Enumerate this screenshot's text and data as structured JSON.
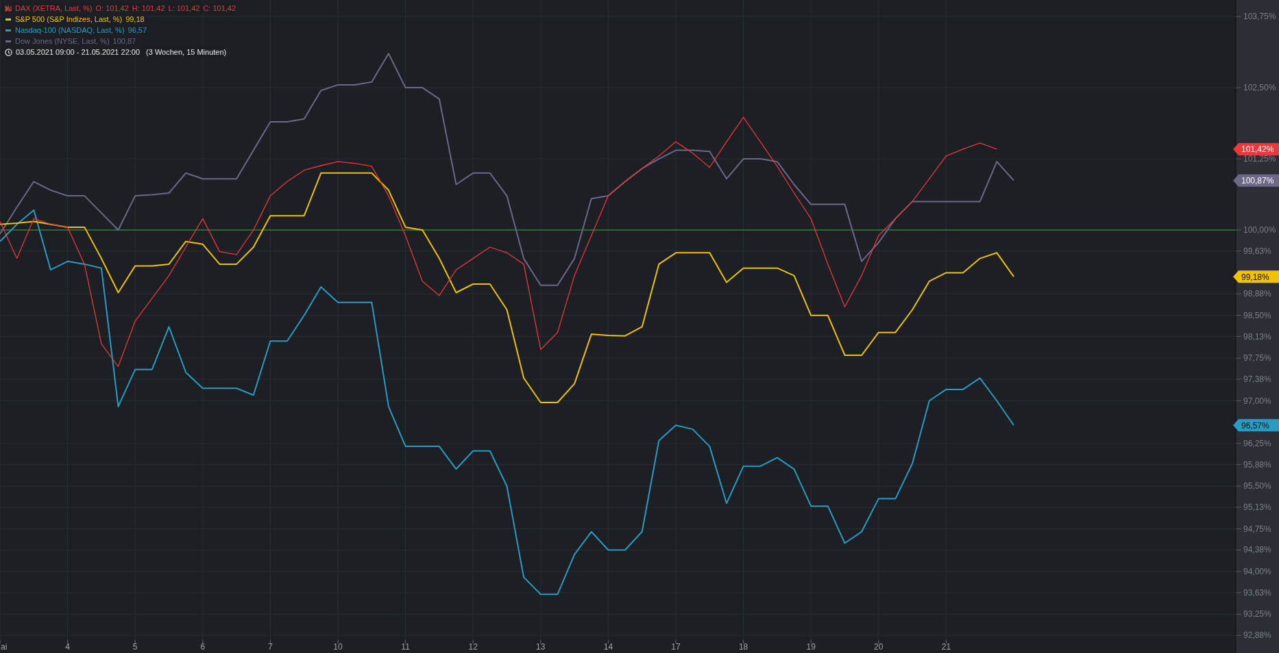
{
  "legend": [
    {
      "kind": "candles",
      "values": [
        "O: 101,42",
        "H: 101,42",
        "L: 101,42",
        "C: 101,42"
      ]
    },
    {
      "kind": "line",
      "values": [
        "99,18"
      ]
    },
    {
      "kind": "line",
      "values": [
        "96,57"
      ]
    },
    {
      "kind": "line",
      "values": [
        "100,87"
      ]
    }
  ],
  "period": {
    "range": "03.05.2021 09:00 - 21.05.2021 22:00",
    "detail": "(3 Wochen, 15 Minuten)"
  },
  "chart_data": {
    "type": "line",
    "ylim": [
      92.57,
      104.04
    ],
    "categories": [
      "ai",
      null,
      null,
      null,
      "4",
      null,
      null,
      null,
      "5",
      null,
      null,
      null,
      "6",
      null,
      null,
      null,
      "7",
      null,
      null,
      null,
      "10",
      null,
      null,
      null,
      "11",
      null,
      null,
      null,
      "12",
      null,
      null,
      null,
      "13",
      null,
      null,
      null,
      "14",
      null,
      null,
      null,
      "17",
      null,
      null,
      null,
      "18",
      null,
      null,
      null,
      "19",
      null,
      null,
      null,
      "20",
      null,
      null,
      null,
      "21",
      null,
      null,
      null,
      null
    ],
    "grid": true,
    "ref_lines": [
      {
        "axis": "y",
        "value": 100,
        "color": "#3aa53a"
      }
    ],
    "yticks": [
      {
        "value": 103.75,
        "label": "103,75%"
      },
      {
        "value": 102.5,
        "label": "102,50%"
      },
      {
        "value": 101.25,
        "label": "101,25%"
      },
      {
        "value": 100,
        "label": "100,00%"
      },
      {
        "value": 99.63,
        "label": "99,63%"
      },
      {
        "value": 98.88,
        "label": "98,88%"
      },
      {
        "value": 98.5,
        "label": "98,50%"
      },
      {
        "value": 98.13,
        "label": "98,13%"
      },
      {
        "value": 97.75,
        "label": "97,75%"
      },
      {
        "value": 97.38,
        "label": "97,38%"
      },
      {
        "value": 97,
        "label": "97,00%"
      },
      {
        "value": 96.25,
        "label": "96,25%"
      },
      {
        "value": 95.88,
        "label": "95,88%"
      },
      {
        "value": 95.5,
        "label": "95,50%"
      },
      {
        "value": 95.13,
        "label": "95,13%"
      },
      {
        "value": 94.75,
        "label": "94,75%"
      },
      {
        "value": 94.38,
        "label": "94,38%"
      },
      {
        "value": 94,
        "label": "94,00%"
      },
      {
        "value": 93.63,
        "label": "93,63%"
      },
      {
        "value": 93.25,
        "label": "93,25%"
      },
      {
        "value": 92.88,
        "label": "92,88%"
      }
    ],
    "series": [
      {
        "name": "DAX (XETRA, Last, %)",
        "color": "#e83a3a",
        "values": [
          100.15,
          99.5,
          100.2,
          100.1,
          100.05,
          99.4,
          98.0,
          97.6,
          98.4,
          98.8,
          99.2,
          99.7,
          100.2,
          99.62,
          99.57,
          100.0,
          100.6,
          100.85,
          101.05,
          101.13,
          101.2,
          101.17,
          101.12,
          100.6,
          99.9,
          99.1,
          98.85,
          99.3,
          99.5,
          99.7,
          99.6,
          99.4,
          97.9,
          98.2,
          99.2,
          99.9,
          100.6,
          100.85,
          101.08,
          101.3,
          101.55,
          101.35,
          101.1,
          101.55,
          101.98,
          101.55,
          101.12,
          100.65,
          100.2,
          99.4,
          98.65,
          99.2,
          99.9,
          100.2,
          100.5,
          100.9,
          101.3,
          101.42,
          101.53,
          101.42,
          null
        ]
      },
      {
        "name": "S&P 500 (S&P Indizes, Last, %)",
        "color": "#f2c200",
        "values": [
          100.1,
          100.12,
          100.15,
          100.1,
          100.05,
          100.05,
          99.5,
          98.9,
          99.37,
          99.37,
          99.4,
          99.8,
          99.75,
          99.4,
          99.4,
          99.7,
          100.25,
          100.25,
          100.25,
          101.0,
          101.0,
          101.0,
          101.0,
          100.7,
          100.05,
          100.0,
          99.5,
          98.9,
          99.05,
          99.05,
          98.6,
          97.4,
          96.97,
          96.97,
          97.3,
          98.17,
          98.15,
          98.14,
          98.3,
          99.4,
          99.6,
          99.6,
          99.6,
          99.08,
          99.33,
          99.33,
          99.33,
          99.2,
          98.5,
          98.5,
          97.8,
          97.8,
          98.2,
          98.2,
          98.6,
          99.1,
          99.25,
          99.25,
          99.5,
          99.6,
          99.18
        ]
      },
      {
        "name": "Nasdaq-100 (NASDAQ, Last, %)",
        "color": "#2a9bc3",
        "values": [
          99.8,
          100.1,
          100.35,
          99.3,
          99.45,
          99.4,
          99.33,
          96.9,
          97.55,
          97.55,
          98.3,
          97.5,
          97.22,
          97.22,
          97.22,
          97.1,
          98.05,
          98.05,
          98.5,
          99.0,
          98.73,
          98.73,
          98.73,
          96.9,
          96.2,
          96.2,
          96.2,
          95.8,
          96.12,
          96.12,
          95.5,
          93.9,
          93.6,
          93.6,
          94.3,
          94.7,
          94.38,
          94.38,
          94.7,
          96.3,
          96.57,
          96.5,
          96.2,
          95.2,
          95.85,
          95.85,
          96.0,
          95.8,
          95.15,
          95.15,
          94.5,
          94.7,
          95.28,
          95.28,
          95.9,
          97.0,
          97.2,
          97.2,
          97.4,
          97.0,
          96.57
        ]
      },
      {
        "name": "Dow Jones (NYSE, Last, %)",
        "color": "#6d6789",
        "values": [
          99.93,
          100.4,
          100.85,
          100.7,
          100.6,
          100.6,
          100.3,
          100.0,
          100.6,
          100.62,
          100.65,
          101.0,
          100.9,
          100.9,
          100.9,
          101.4,
          101.9,
          101.9,
          101.95,
          102.45,
          102.55,
          102.55,
          102.6,
          103.1,
          102.5,
          102.5,
          102.3,
          100.8,
          101.0,
          101.0,
          100.6,
          99.5,
          99.03,
          99.03,
          99.5,
          100.55,
          100.6,
          100.85,
          101.08,
          101.25,
          101.4,
          101.4,
          101.38,
          100.9,
          101.25,
          101.25,
          101.2,
          100.8,
          100.45,
          100.45,
          100.45,
          99.45,
          99.78,
          100.2,
          100.5,
          100.5,
          100.5,
          100.5,
          100.5,
          101.2,
          100.87
        ]
      }
    ],
    "annotations": [
      "101,42%",
      "100,87%",
      "99,18%",
      "96,57%"
    ]
  }
}
